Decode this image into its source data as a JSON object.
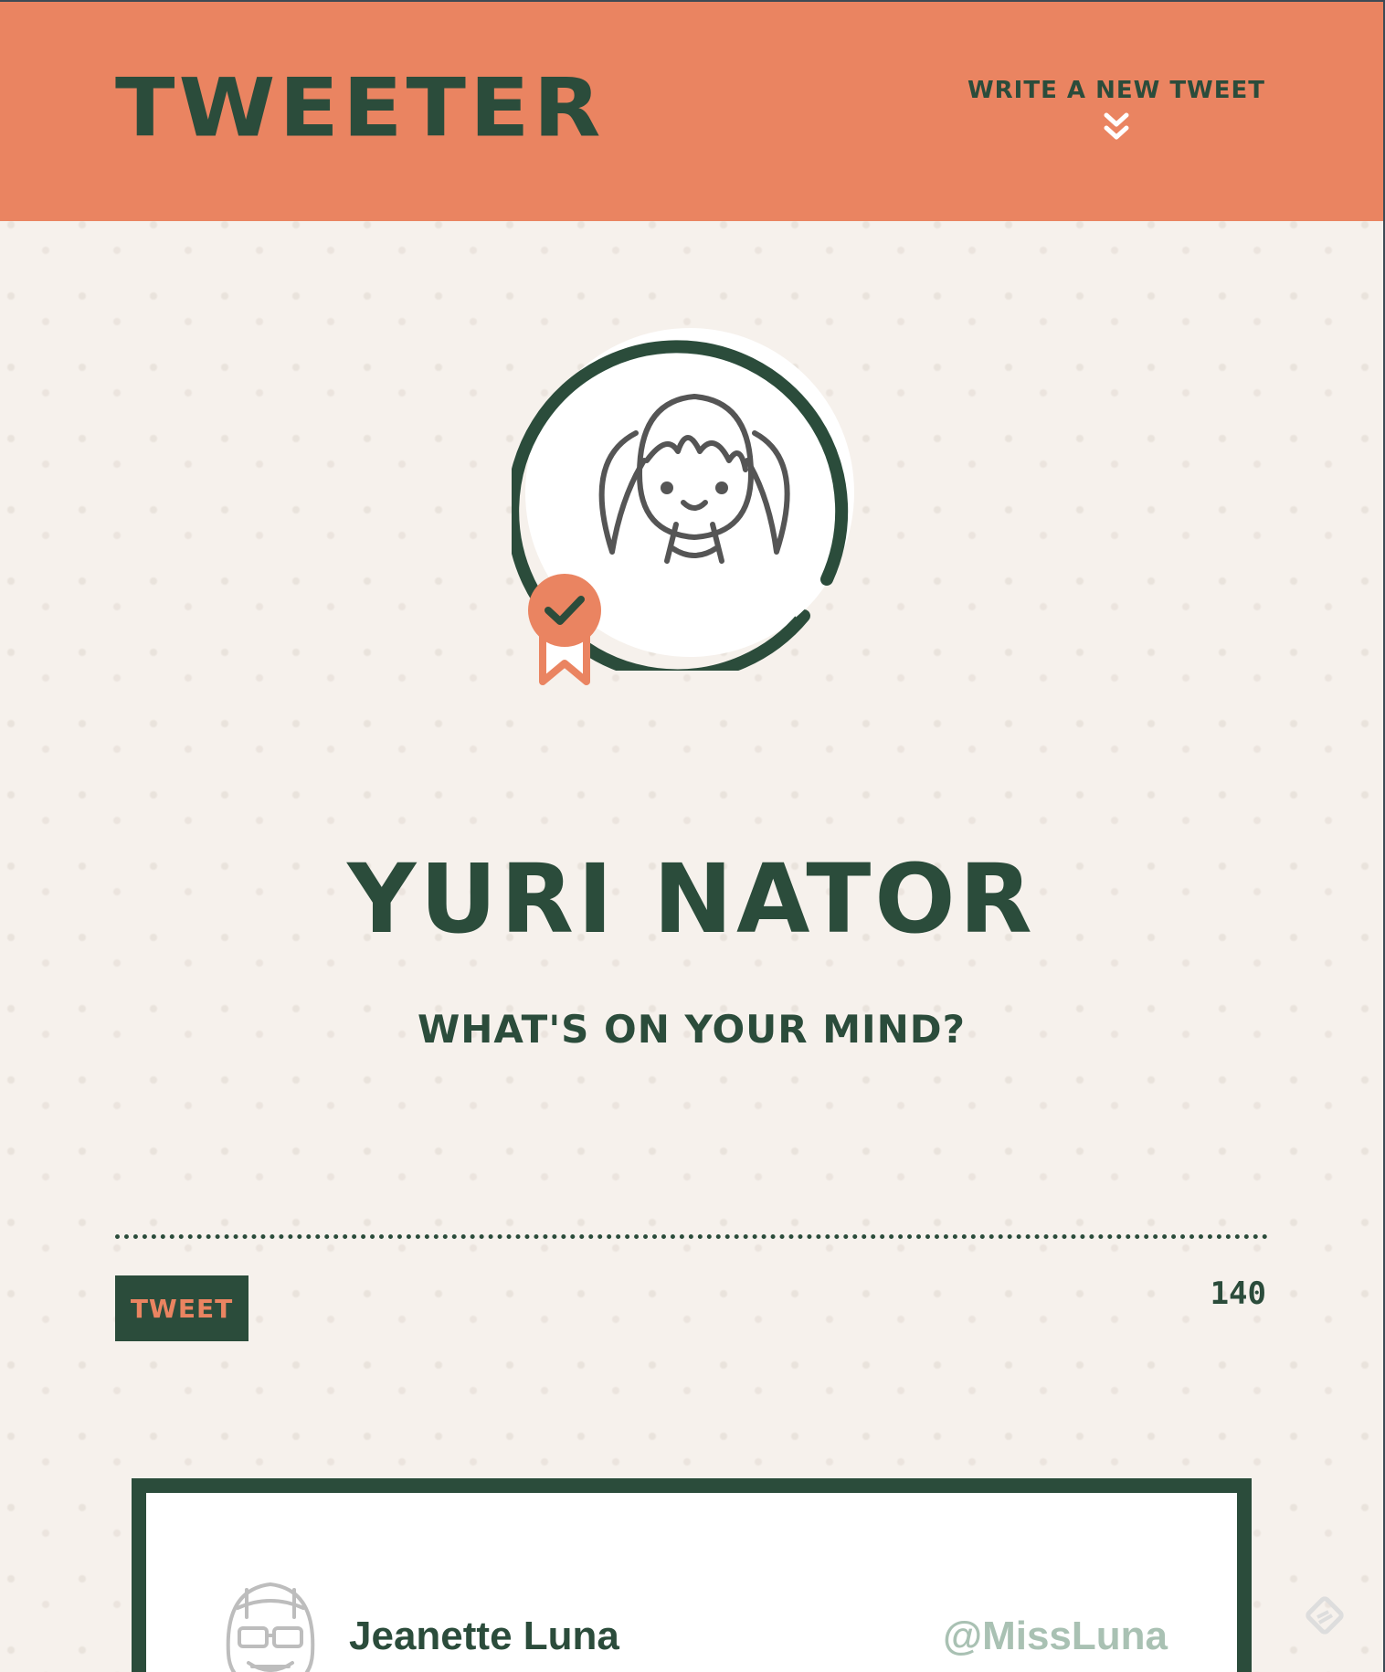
{
  "header": {
    "brand": "TWEETER",
    "compose_toggle_label": "WRITE A NEW TWEET",
    "compose_toggle_icon": "double-chevron-down-icon"
  },
  "profile": {
    "name": "YURI NATOR",
    "avatar_icon": "girl-with-pigtails-avatar-icon",
    "verified_icon": "verified-ribbon-badge-icon"
  },
  "compose": {
    "prompt": "WHAT'S ON YOUR MIND?",
    "text": "",
    "submit_label": "TWEET",
    "chars_remaining": "140"
  },
  "tweets": [
    {
      "author": "Jeanette Luna",
      "handle": "@MissLuna",
      "avatar_icon": "football-helmet-avatar-icon"
    }
  ],
  "colors": {
    "header_bg": "#ea8461",
    "brand_green": "#2b4c3b",
    "page_bg": "#f6f1ec",
    "handle_gray": "#a9c1b3"
  }
}
